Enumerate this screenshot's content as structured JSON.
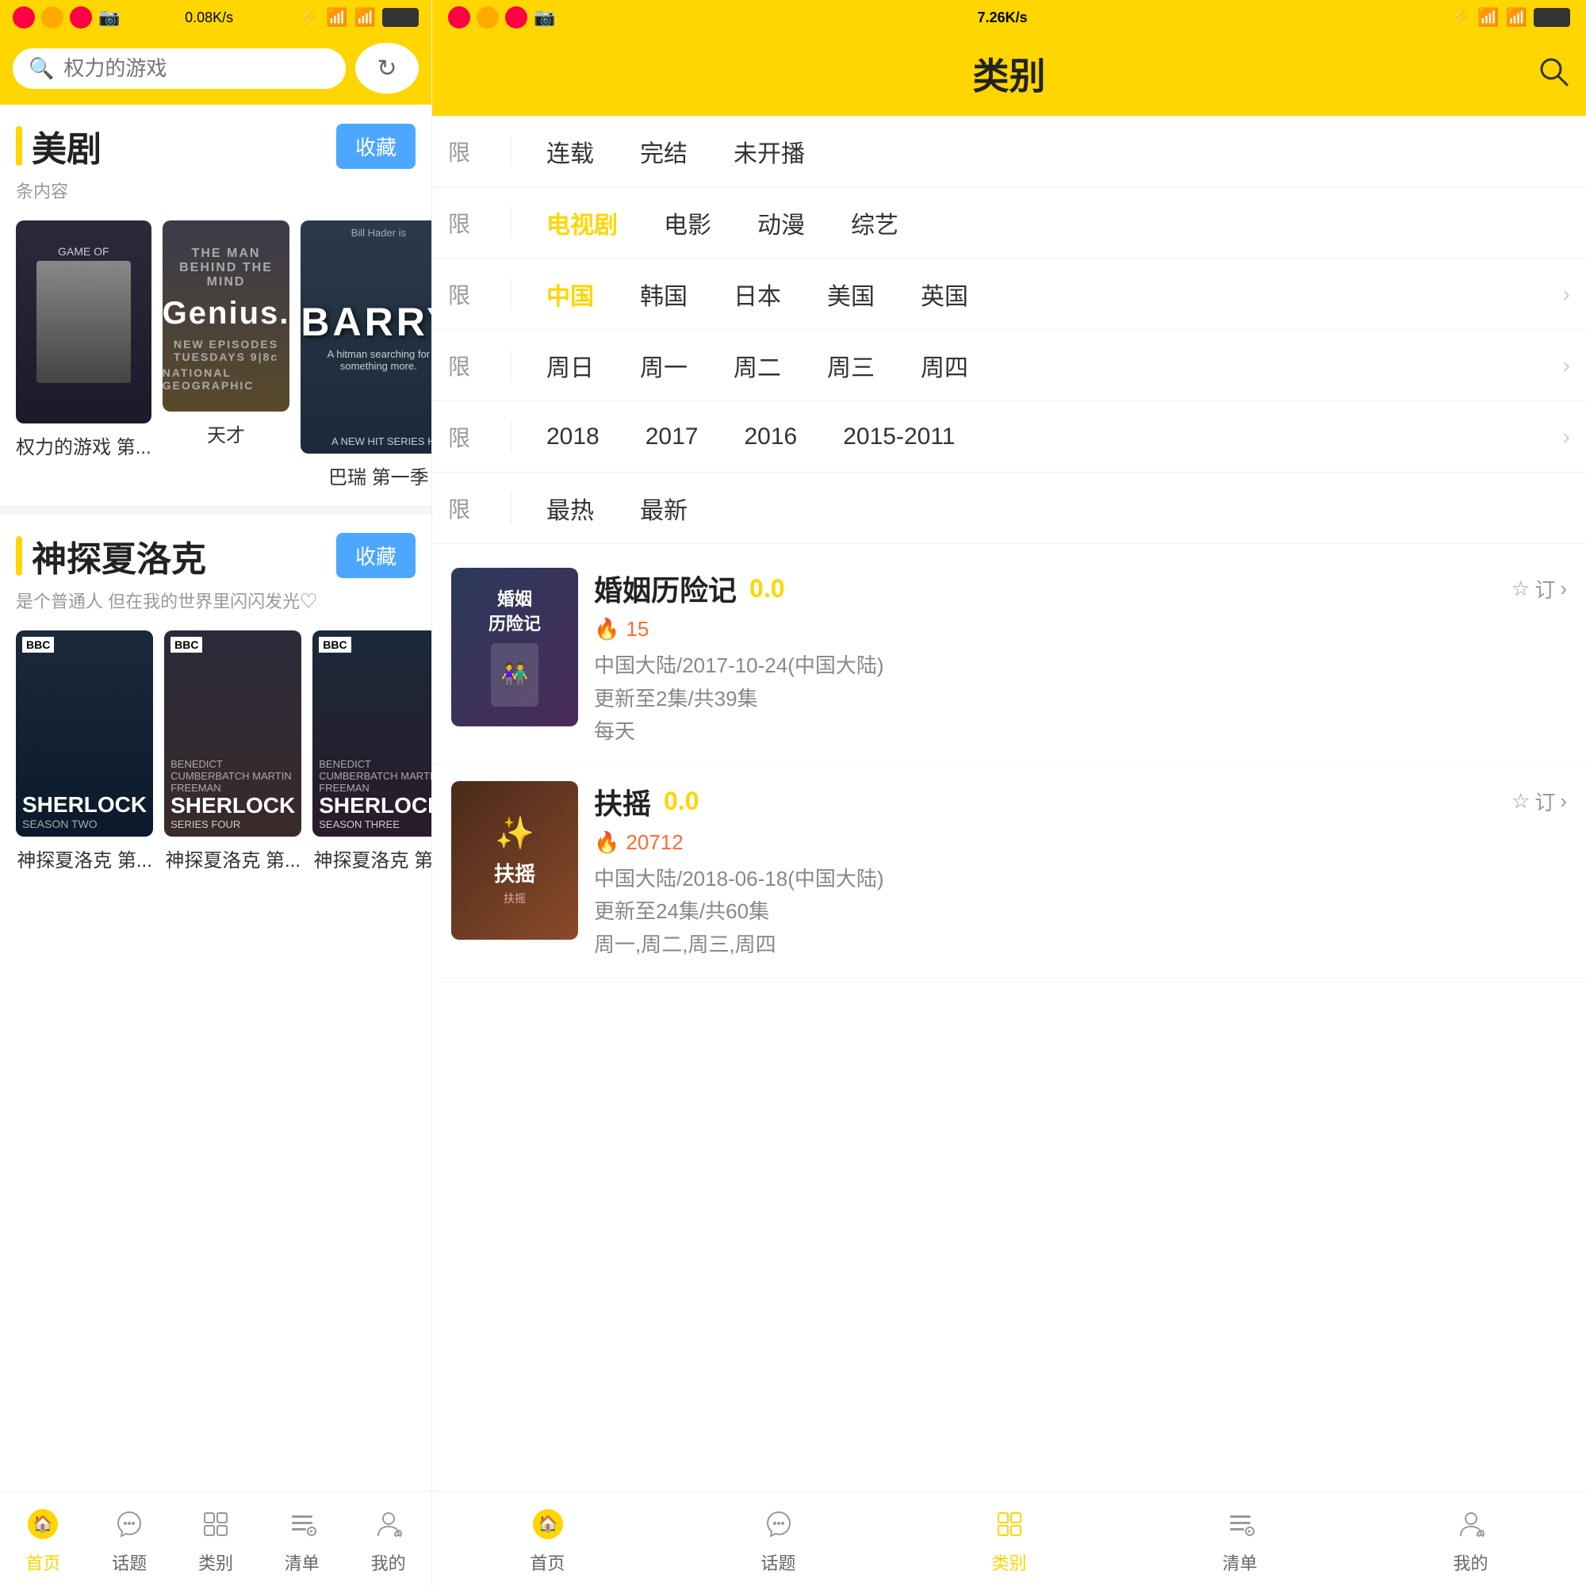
{
  "left": {
    "statusBar": {
      "speed": "0.08K/s",
      "icons": [
        "🔵",
        "🟠",
        "🔴",
        "📷"
      ]
    },
    "search": {
      "placeholder": "权力的游戏",
      "btnIcon": "↻"
    },
    "sections": [
      {
        "id": "meiju",
        "title": "美剧",
        "sub": "条内容",
        "collectLabel": "收藏",
        "shows": [
          {
            "id": "got",
            "name": "权力的游戏 第...",
            "posterType": "got"
          },
          {
            "id": "genius",
            "name": "天才",
            "posterType": "genius"
          },
          {
            "id": "barry",
            "name": "巴瑞 第一季",
            "posterType": "barry"
          }
        ]
      },
      {
        "id": "sherlock",
        "title": "神探夏洛克",
        "sub": "是个普通人 但在我的世界里闪闪发光♡",
        "collectLabel": "收藏",
        "shows": [
          {
            "id": "sh1",
            "name": "神探夏洛克 第...",
            "posterType": "sherlock1"
          },
          {
            "id": "sh2",
            "name": "神探夏洛克 第...",
            "posterType": "sherlock2"
          },
          {
            "id": "sh3",
            "name": "神探夏洛克 第...",
            "posterType": "sherlock3"
          }
        ]
      }
    ],
    "bottomNav": [
      {
        "id": "home",
        "icon": "🏠",
        "label": "首页",
        "active": true
      },
      {
        "id": "topic",
        "icon": "❤",
        "label": "话题",
        "active": false
      },
      {
        "id": "category",
        "icon": "⊞",
        "label": "类别",
        "active": false
      },
      {
        "id": "playlist",
        "icon": "📋",
        "label": "清单",
        "active": false
      },
      {
        "id": "mine",
        "icon": "🐱",
        "label": "我的",
        "active": false
      }
    ]
  },
  "right": {
    "statusBar": {
      "speed": "7.26K/s"
    },
    "header": {
      "title": "类别",
      "searchIcon": "🔍"
    },
    "filters": [
      {
        "id": "status",
        "label": "限",
        "options": [
          "连载",
          "完结",
          "未开播"
        ],
        "activeIndex": -1
      },
      {
        "id": "type",
        "label": "限",
        "options": [
          "电视剧",
          "电影",
          "动漫",
          "综艺"
        ],
        "activeIndex": 0
      },
      {
        "id": "region",
        "label": "限",
        "options": [
          "中国",
          "韩国",
          "日本",
          "美国",
          "英国"
        ],
        "activeIndex": 0
      },
      {
        "id": "day",
        "label": "限",
        "options": [
          "周日",
          "周一",
          "周二",
          "周三",
          "周四"
        ],
        "activeIndex": -1
      },
      {
        "id": "year",
        "label": "限",
        "options": [
          "2018",
          "2017",
          "2016",
          "2015-2011"
        ],
        "activeIndex": -1
      },
      {
        "id": "sort",
        "label": "限",
        "options": [
          "最热",
          "最新"
        ],
        "activeIndex": -1
      }
    ],
    "showList": [
      {
        "id": "marriage",
        "title": "婚姻历险记",
        "score": "0.0",
        "subscribeLabel": "☆ 订",
        "hot": "15",
        "meta1": "中国大陆/2017-10-24(中国大陆)",
        "meta2": "更新至2集/共39集",
        "meta3": "每天",
        "posterType": "marriage"
      },
      {
        "id": "fuyao",
        "title": "扶摇",
        "score": "0.0",
        "subscribeLabel": "☆ 订",
        "hot": "20712",
        "meta1": "中国大陆/2018-06-18(中国大陆)",
        "meta2": "更新至24集/共60集",
        "meta3": "周一,周二,周三,周四",
        "posterType": "fuyao"
      }
    ],
    "bottomNav": [
      {
        "id": "home",
        "icon": "🏠",
        "label": "首页",
        "active": false
      },
      {
        "id": "topic",
        "icon": "❤",
        "label": "话题",
        "active": false
      },
      {
        "id": "category",
        "icon": "⊞",
        "label": "类别",
        "active": true
      },
      {
        "id": "playlist",
        "icon": "📋",
        "label": "清单",
        "active": false
      },
      {
        "id": "mine",
        "icon": "🐱",
        "label": "我的",
        "active": false
      }
    ]
  }
}
